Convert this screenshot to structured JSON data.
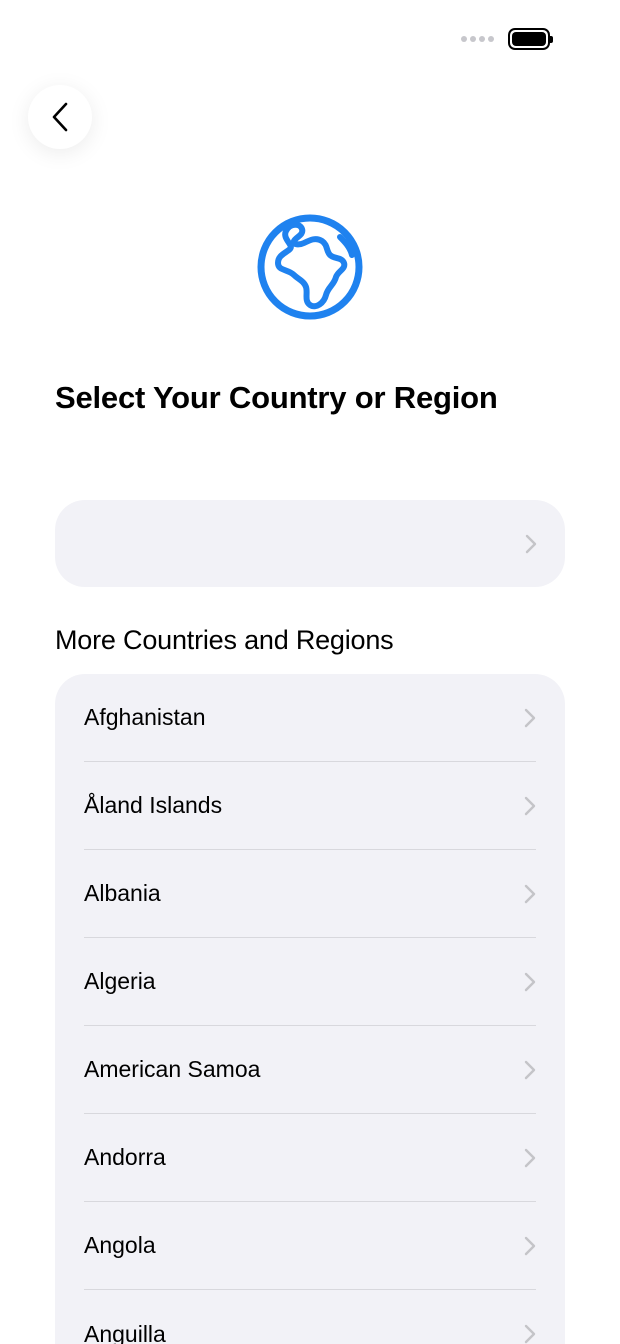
{
  "header": {
    "title": "Select Your Country or Region",
    "back_icon": "chevron-left-icon",
    "globe_icon": "globe-icon"
  },
  "suggested": {
    "label": ""
  },
  "section": {
    "title": "More Countries and Regions"
  },
  "countries": [
    {
      "label": "Afghanistan"
    },
    {
      "label": "Åland Islands"
    },
    {
      "label": "Albania"
    },
    {
      "label": "Algeria"
    },
    {
      "label": "American Samoa"
    },
    {
      "label": "Andorra"
    },
    {
      "label": "Angola"
    },
    {
      "label": "Anguilla"
    }
  ],
  "colors": {
    "accent": "#1f82ef",
    "row_background": "#f2f2f7",
    "chevron": "#c4c4c8",
    "separator": "#d8d8dd"
  }
}
